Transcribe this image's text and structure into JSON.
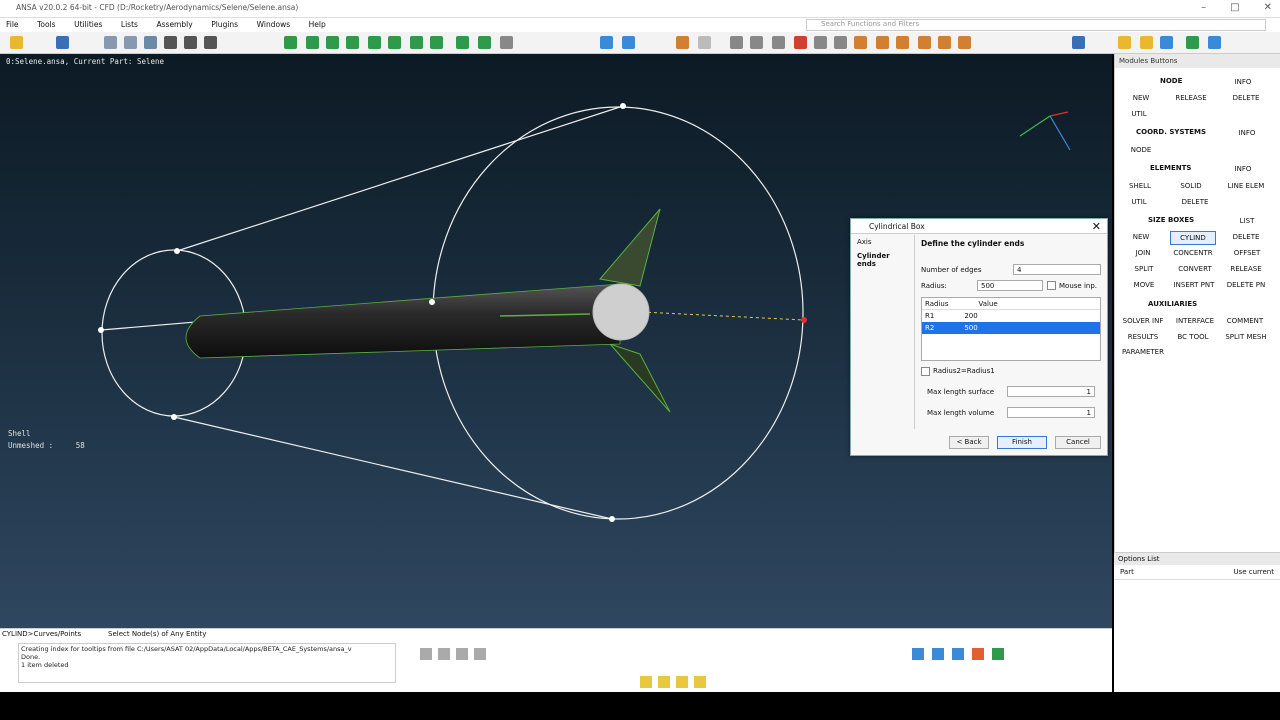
{
  "window": {
    "title": "ANSA v20.0.2 64-bit - CFD (D:/Rocketry/Aerodynamics/Selene/Selene.ansa)",
    "search_placeholder": "Search Functions and Filters"
  },
  "menu": [
    "File",
    "Tools",
    "Utilities",
    "Lists",
    "Assembly",
    "Plugins",
    "Windows",
    "Help"
  ],
  "viewport": {
    "info": "0:Selene.ansa,  Current Part: Selene",
    "shell_label": "Shell",
    "unmeshed_label": "Unmeshed :",
    "unmeshed_value": "58"
  },
  "modules": {
    "header": "Modules Buttons",
    "node": {
      "title": "NODE",
      "info": "INFO",
      "new": "NEW",
      "release": "RELEASE",
      "delete": "DELETE",
      "util": "UTIL"
    },
    "coord": {
      "title": "COORD. SYSTEMS",
      "info": "INFO",
      "node": "NODE"
    },
    "elements": {
      "title": "ELEMENTS",
      "info": "INFO",
      "shell": "SHELL",
      "solid": "SOLID",
      "line_elem": "LINE ELEM",
      "util": "UTIL",
      "delete": "DELETE"
    },
    "size_boxes": {
      "title": "SIZE BOXES",
      "list": "LIST",
      "new": "NEW",
      "cylind": "CYLIND",
      "delete": "DELETE",
      "join": "JOIN",
      "concentr": "CONCENTR",
      "offset": "OFFSET",
      "split": "SPLIT",
      "convert": "CONVERT",
      "release": "RELEASE",
      "move": "MOVE",
      "insert_pnt": "INSERT PNT",
      "delete_pn": "DELETE PN"
    },
    "auxiliaries": {
      "title": "AUXILIARIES",
      "solver_inf": "SOLVER INF",
      "interface": "INTERFACE",
      "comment": "COMMENT",
      "results": "RESULTS",
      "bc_tool": "BC TOOL",
      "split_mesh": "SPLIT MESH",
      "parameter": "PARAMETER"
    }
  },
  "options": {
    "header": "Options List",
    "row_label": "Part",
    "row_value": "Use current"
  },
  "dialog": {
    "title": "Cylindrical Box",
    "steps": [
      "Axis",
      "Cylinder ends"
    ],
    "heading": "Define the cylinder ends",
    "edges_label": "Number of edges",
    "edges_value": "4",
    "radius_label": "Radius:",
    "radius_value": "500",
    "mouse_label": "Mouse inp.",
    "table_headers": [
      "Radius",
      "Value"
    ],
    "rows": [
      {
        "name": "R1",
        "value": "200"
      },
      {
        "name": "R2",
        "value": "500"
      }
    ],
    "radius_eq_label": "Radius2=Radius1",
    "max_surface_label": "Max length surface",
    "max_surface_value": "1",
    "max_volume_label": "Max length volume",
    "max_volume_value": "1",
    "back_label": "< Back",
    "finish_label": "Finish",
    "cancel_label": "Cancel"
  },
  "status": {
    "cmd": "CYLIND>Curves/Points",
    "prompt": "Select Node(s) of Any Entity",
    "log_lines": [
      "Creating index for tooltips from file C:/Users/ASAT 02/AppData/Local/Apps/BETA_CAE_Systems/ansa_v",
      "Done.",
      "1 item deleted"
    ]
  },
  "colors": {
    "accent": "#1e73e8",
    "viewport_top": "#0c1a24",
    "viewport_bottom": "#2f4760"
  }
}
